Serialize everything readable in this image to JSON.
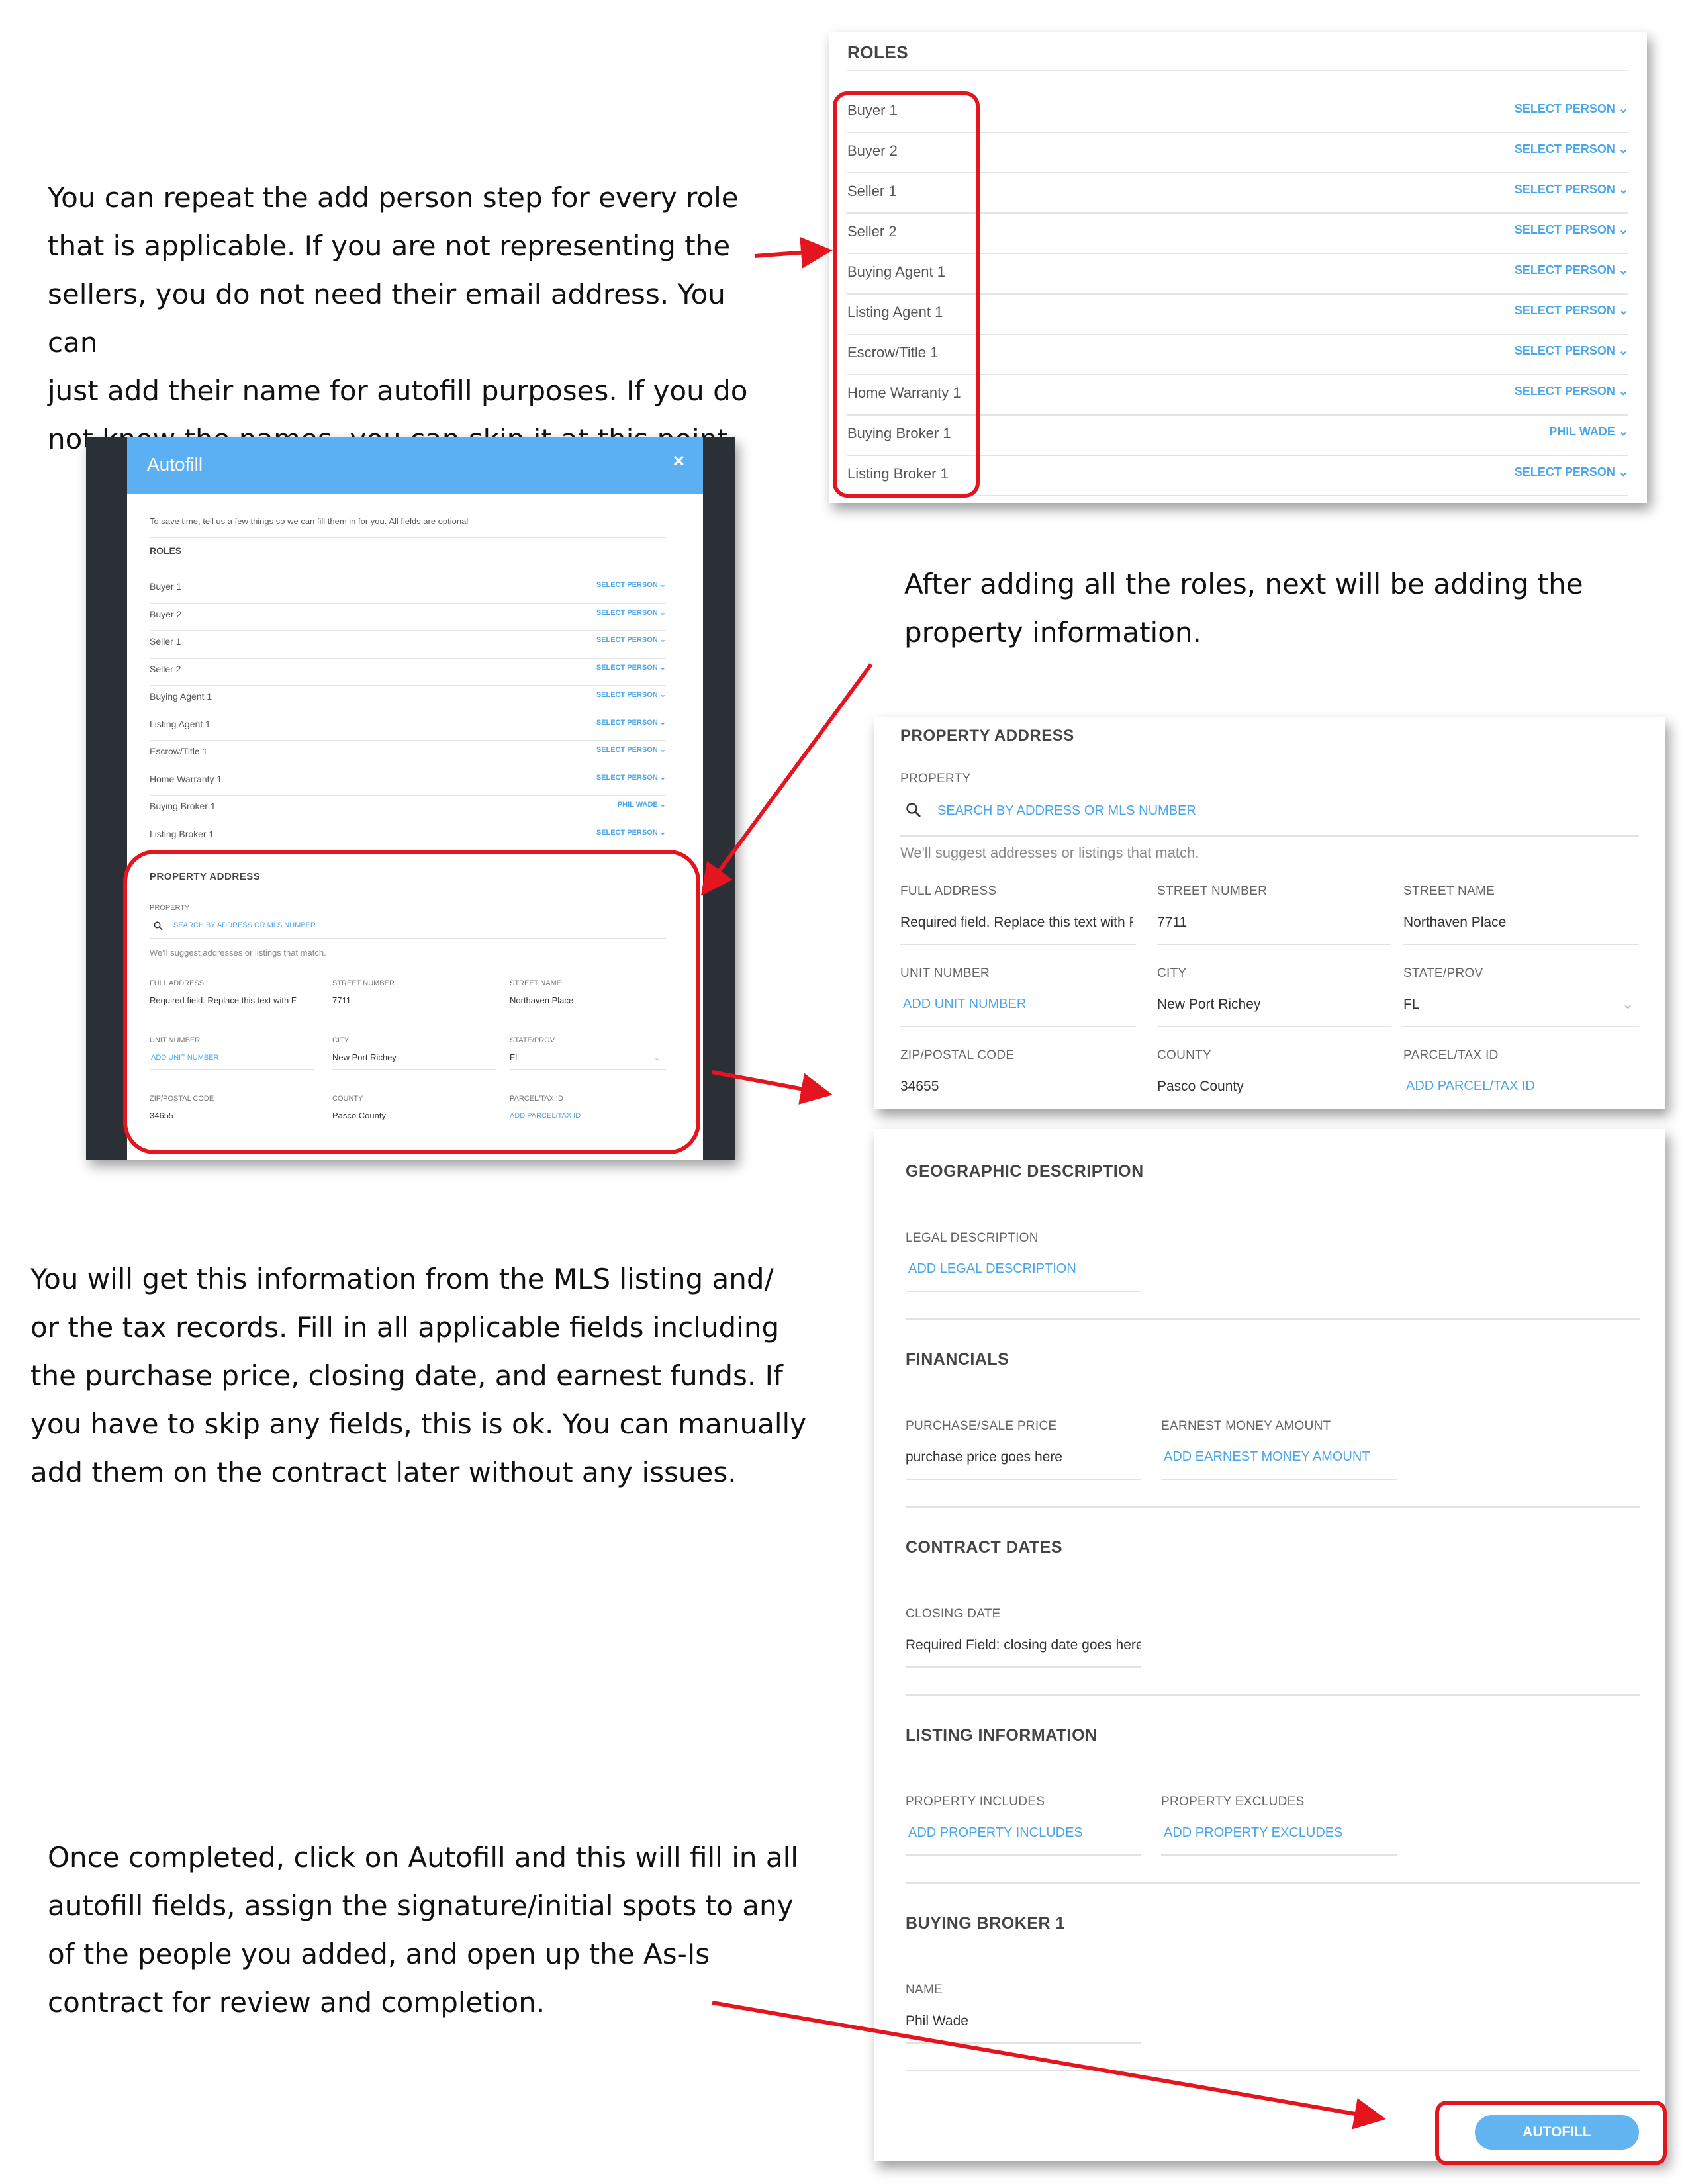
{
  "instructions": {
    "p1": "You can repeat the add person step for every role\nthat is applicable.  If you are not representing the\nsellers, you do not need their email address. You can\njust add their name for autofill purposes. If you do\nnot know the names, you can skip it at this point.",
    "p2": "After adding all the roles, next will be adding the\nproperty information.",
    "p3": "You will get this information from the MLS listing and/\nor the tax records. Fill in all applicable fields including\nthe purchase price, closing date, and earnest funds. If\nyou have to skip any fields, this is ok. You can manually\nadd them on the contract later without any issues.",
    "p4": "Once completed, click on Autofill and this will fill in all\nautofill fields, assign the signature/initial spots to any\nof the people you added, and open up the As-Is\ncontract for review and completion."
  },
  "roles_panel": {
    "title": "ROLES",
    "roles": [
      {
        "name": "Buyer 1",
        "action": "SELECT PERSON"
      },
      {
        "name": "Buyer 2",
        "action": "SELECT PERSON"
      },
      {
        "name": "Seller 1",
        "action": "SELECT PERSON"
      },
      {
        "name": "Seller 2",
        "action": "SELECT PERSON"
      },
      {
        "name": "Buying Agent 1",
        "action": "SELECT PERSON"
      },
      {
        "name": "Listing Agent 1",
        "action": "SELECT PERSON"
      },
      {
        "name": "Escrow/Title 1",
        "action": "SELECT PERSON"
      },
      {
        "name": "Home Warranty 1",
        "action": "SELECT PERSON"
      },
      {
        "name": "Buying Broker 1",
        "action": "PHIL WADE"
      },
      {
        "name": "Listing Broker 1",
        "action": "SELECT PERSON"
      }
    ]
  },
  "autofill_modal": {
    "title": "Autofill",
    "close": "×",
    "intro": "To save time, tell us a few things so we can fill them in for you. All fields are optional",
    "roles_title": "ROLES"
  },
  "property": {
    "title": "PROPERTY ADDRESS",
    "property_label": "PROPERTY",
    "search_placeholder": "SEARCH BY ADDRESS OR MLS NUMBER",
    "hint": "We'll suggest addresses or listings that match.",
    "full_address_label": "FULL ADDRESS",
    "full_address": "Required field.  Replace this text with F",
    "street_number_label": "STREET NUMBER",
    "street_number": "7711",
    "street_name_label": "STREET NAME",
    "street_name": "Northaven Place",
    "unit_label": "UNIT NUMBER",
    "unit_link": "ADD UNIT NUMBER",
    "city_label": "CITY",
    "city": "New Port Richey",
    "state_label": "STATE/PROV",
    "state": "FL",
    "zip_label": "ZIP/POSTAL CODE",
    "zip": "34655",
    "county_label": "COUNTY",
    "county": "Pasco County",
    "parcel_label": "PARCEL/TAX ID",
    "parcel_link": "ADD PARCEL/TAX ID"
  },
  "details": {
    "geo_title": "GEOGRAPHIC DESCRIPTION",
    "legal_label": "LEGAL DESCRIPTION",
    "legal_link": "ADD LEGAL DESCRIPTION",
    "fin_title": "FINANCIALS",
    "price_label": "PURCHASE/SALE PRICE",
    "price_value": "purchase price goes here",
    "earnest_label": "EARNEST MONEY AMOUNT",
    "earnest_link": "ADD EARNEST MONEY AMOUNT",
    "dates_title": "CONTRACT DATES",
    "closing_label": "CLOSING DATE",
    "closing_value": "Required Field: closing date goes here",
    "listing_title": "LISTING INFORMATION",
    "includes_label": "PROPERTY INCLUDES",
    "includes_link": "ADD PROPERTY INCLUDES",
    "excludes_label": "PROPERTY EXCLUDES",
    "excludes_link": "ADD PROPERTY EXCLUDES",
    "broker_title": "BUYING BROKER 1",
    "name_label": "NAME",
    "name_value": "Phil Wade",
    "autofill_button": "AUTOFILL"
  },
  "colors": {
    "accent": "#4aa6ea",
    "highlight": "#e4151f",
    "modal_header": "#5bb0f4"
  }
}
